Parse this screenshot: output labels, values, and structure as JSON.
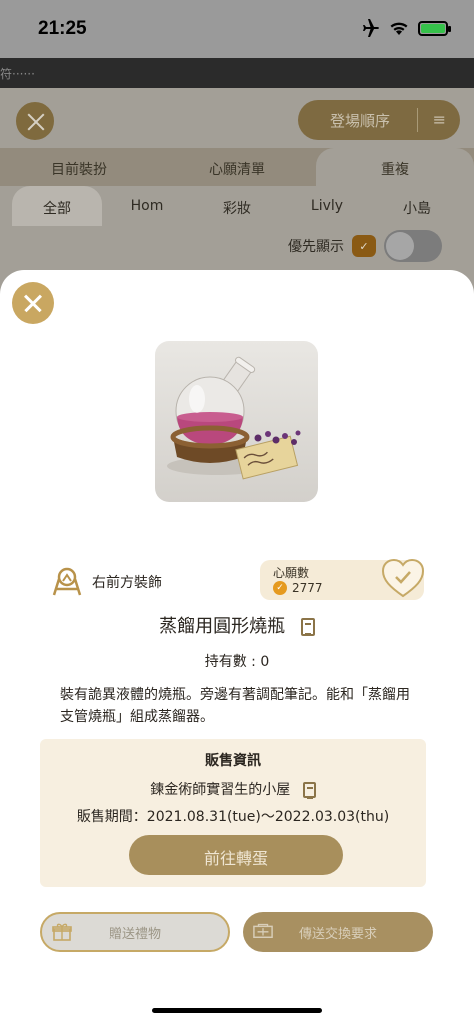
{
  "status_bar": {
    "time": "21:25",
    "icons": [
      "airplane-icon",
      "wifi-icon",
      "battery-charging-icon"
    ]
  },
  "marquee": {
    "text": "符······"
  },
  "background_page": {
    "sort_label": "登場順序",
    "tabs": [
      {
        "label": "目前裝扮",
        "active": false
      },
      {
        "label": "心願清單",
        "active": false
      },
      {
        "label": "重複",
        "active": true
      }
    ],
    "subtabs": [
      {
        "label": "全部",
        "active": true
      },
      {
        "label": "Hom",
        "active": false
      },
      {
        "label": "彩妝",
        "active": false
      },
      {
        "label": "Livly",
        "active": false
      },
      {
        "label": "小島",
        "active": false
      }
    ],
    "priority_label": "優先顯示"
  },
  "item": {
    "category": "右前方裝飾",
    "wish_label": "心願數",
    "wish_count": "2777",
    "name": "蒸餾用圓形燒瓶",
    "owned": "持有數 : 0",
    "description": "裝有詭異液體的燒瓶。旁邊有著調配筆記。能和「蒸餾用支管燒瓶」組成蒸餾器。"
  },
  "sale": {
    "title": "販售資訊",
    "shop": "鍊金術師實習生的小屋",
    "period": "販售期間：2021.08.31(tue)〜2022.03.03(thu)",
    "gacha_button": "前往轉蛋"
  },
  "actions": {
    "gift_button": "贈送禮物",
    "trade_button": "傳送交換要求"
  },
  "colors": {
    "accent_gold": "#c9a761",
    "button_brown": "#a88f5c",
    "sale_bg": "#f7efe0",
    "overlay_dim": "#a39f97"
  }
}
